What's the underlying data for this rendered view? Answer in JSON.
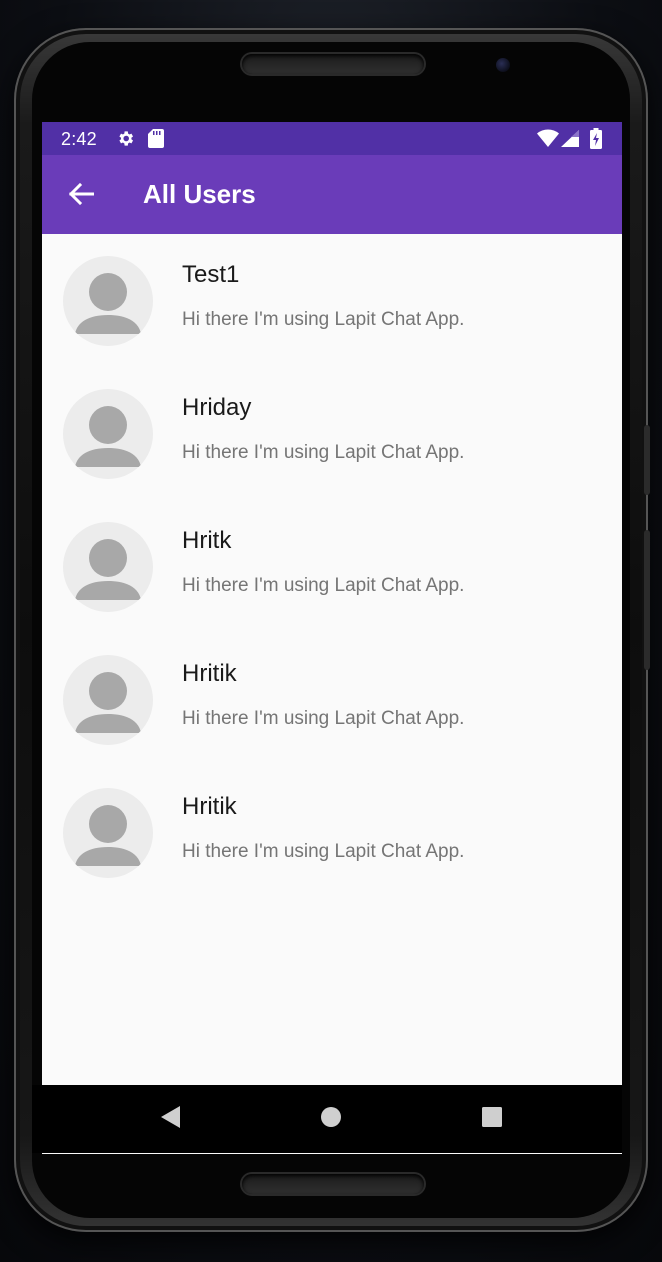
{
  "status_bar": {
    "time": "2:42",
    "left_icons": [
      "gear-icon",
      "sd-card-icon"
    ],
    "right_icons": [
      "wifi-icon",
      "cell-signal-icon",
      "battery-charging-icon"
    ],
    "background": "#5130a6"
  },
  "app_bar": {
    "title": "All Users",
    "back_icon": "arrow-left-icon",
    "background": "#6a3cb9"
  },
  "users": [
    {
      "name": "Test1",
      "status": "Hi there I'm using Lapit Chat App."
    },
    {
      "name": "Hriday",
      "status": "Hi there I'm using Lapit Chat App."
    },
    {
      "name": "Hritk",
      "status": "Hi there I'm using Lapit Chat App."
    },
    {
      "name": "Hritik",
      "status": "Hi there I'm using Lapit Chat App."
    },
    {
      "name": "Hritik",
      "status": "Hi there I'm using Lapit Chat App."
    }
  ],
  "navigation": {
    "buttons": [
      "back-triangle-icon",
      "home-circle-icon",
      "recents-square-icon"
    ]
  }
}
